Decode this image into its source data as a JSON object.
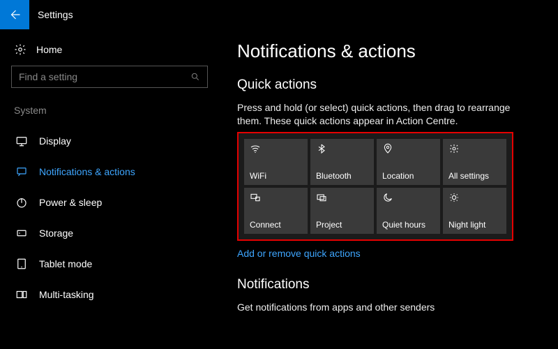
{
  "header": {
    "title": "Settings"
  },
  "sidebar": {
    "home_label": "Home",
    "search_placeholder": "Find a setting",
    "category_label": "System",
    "items": [
      {
        "label": "Display"
      },
      {
        "label": "Notifications & actions"
      },
      {
        "label": "Power & sleep"
      },
      {
        "label": "Storage"
      },
      {
        "label": "Tablet mode"
      },
      {
        "label": "Multi-tasking"
      }
    ]
  },
  "main": {
    "page_title": "Notifications & actions",
    "quick_actions_title": "Quick actions",
    "quick_actions_desc": "Press and hold (or select) quick actions, then drag to rearrange them. These quick actions appear in Action Centre.",
    "tiles": [
      {
        "label": "WiFi"
      },
      {
        "label": "Bluetooth"
      },
      {
        "label": "Location"
      },
      {
        "label": "All settings"
      },
      {
        "label": "Connect"
      },
      {
        "label": "Project"
      },
      {
        "label": "Quiet hours"
      },
      {
        "label": "Night light"
      }
    ],
    "add_remove_link": "Add or remove quick actions",
    "notifications_title": "Notifications",
    "notifications_desc": "Get notifications from apps and other senders"
  }
}
